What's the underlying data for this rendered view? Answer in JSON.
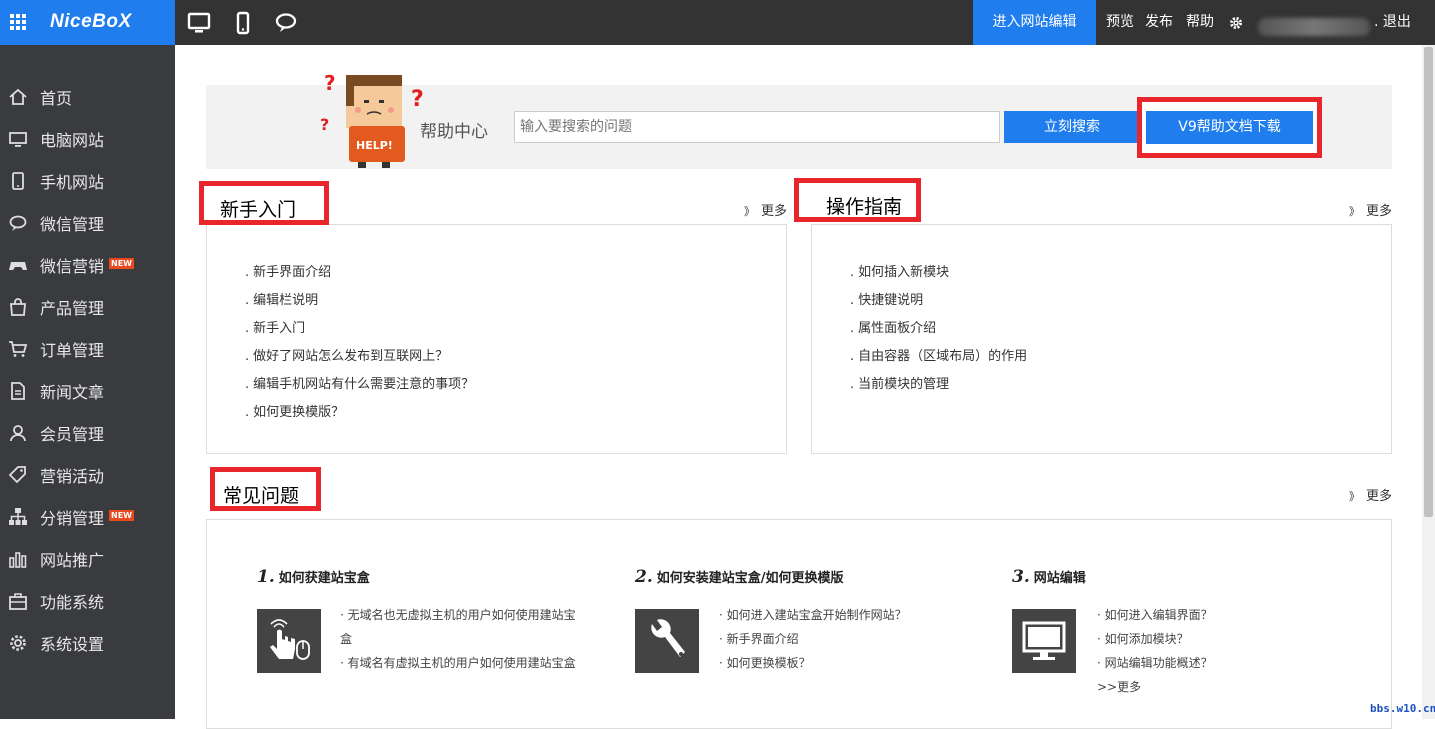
{
  "brand": {
    "logo": "NiceBoX"
  },
  "topbar": {
    "edit_label": "进入网站编辑",
    "preview": "预览",
    "publish": "发布",
    "help": "帮助",
    "logout": "退出"
  },
  "sidebar": {
    "items": [
      {
        "label": "首页",
        "icon": "home-icon"
      },
      {
        "label": "电脑网站",
        "icon": "monitor-icon"
      },
      {
        "label": "手机网站",
        "icon": "phone-icon"
      },
      {
        "label": "微信管理",
        "icon": "chat-icon"
      },
      {
        "label": "微信营销",
        "icon": "gamepad-icon",
        "badge": "NEW"
      },
      {
        "label": "产品管理",
        "icon": "bag-icon"
      },
      {
        "label": "订单管理",
        "icon": "cart-icon"
      },
      {
        "label": "新闻文章",
        "icon": "document-icon"
      },
      {
        "label": "会员管理",
        "icon": "user-icon"
      },
      {
        "label": "营销活动",
        "icon": "tag-icon"
      },
      {
        "label": "分销管理",
        "icon": "sitemap-icon",
        "badge": "NEW"
      },
      {
        "label": "网站推广",
        "icon": "bar-chart-icon"
      },
      {
        "label": "功能系统",
        "icon": "toolbox-icon"
      },
      {
        "label": "系统设置",
        "icon": "gear-icon"
      }
    ]
  },
  "help": {
    "mascot_text": "HELP!",
    "title": "帮助中心",
    "search_placeholder": "输入要搜索的问题",
    "search_button": "立刻搜索",
    "download_button": "V9帮助文档下载"
  },
  "beginner": {
    "title": "新手入门",
    "more": "更多",
    "items": [
      "新手界面介绍",
      "编辑栏说明",
      "新手入门",
      "做好了网站怎么发布到互联网上？",
      "编辑手机网站有什么需要注意的事项？",
      "如何更换模版？"
    ]
  },
  "guide": {
    "title": "操作指南",
    "more": "更多",
    "items": [
      "如何插入新模块",
      "快捷键说明",
      "属性面板介绍",
      "自由容器（区域布局）的作用",
      "当前模块的管理"
    ]
  },
  "faq": {
    "title": "常见问题",
    "more": "更多",
    "columns": [
      {
        "num": "1.",
        "title": "如何获建站宝盒",
        "icon": "click-mouse-icon",
        "items": [
          "· 无域名也无虚拟主机的用户如何使用建站宝盒",
          "· 有域名有虚拟主机的用户如何使用建站宝盒"
        ]
      },
      {
        "num": "2.",
        "title": "如何安装建站宝盒/如何更换模版",
        "icon": "wrench-icon",
        "items": [
          "· 如何进入建站宝盒开始制作网站？",
          "· 新手界面介绍",
          "· 如何更换模板？"
        ]
      },
      {
        "num": "3.",
        "title": "网站编辑",
        "icon": "monitor-icon",
        "items": [
          "· 如何进入编辑界面？",
          "· 如何添加模块？",
          "· 网站编辑功能概述？",
          ">>更多"
        ]
      }
    ]
  },
  "watermark": "bbs.w10.cn",
  "colors": {
    "accent": "#1f7ded",
    "highlight": "#e8262b",
    "sidebar": "#3a3b3f",
    "topbar": "#333333"
  }
}
